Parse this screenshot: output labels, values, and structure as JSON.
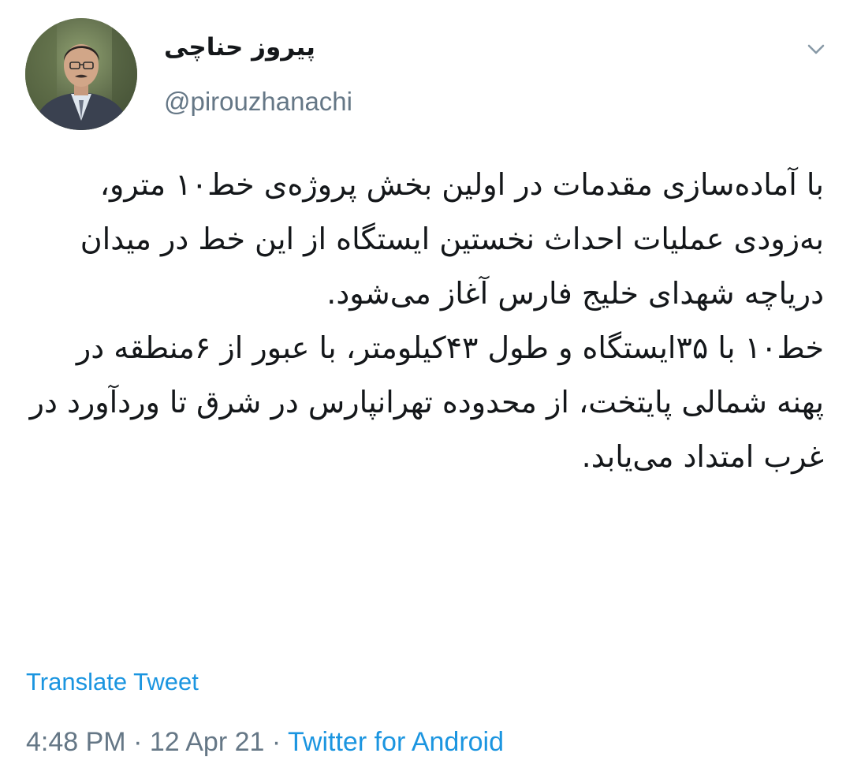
{
  "author": {
    "display_name": "پیروز حناچی",
    "handle": "@pirouzhanachi",
    "avatar_icon": "profile-photo"
  },
  "menu": {
    "caret_icon": "chevron-down-icon"
  },
  "tweet": {
    "paragraph_1": "با آماده‌سازی مقدمات در اولین بخش پروژه‌ی خط۱۰ مترو، به‌زودی عملیات احداث نخستین ایستگاه از این خط در میدان دریاچه شهدای خلیج فارس آغاز می‌شود.",
    "paragraph_2": "خط۱۰ با ۳۵ایستگاه و طول ۴۳کیلومتر، با عبور از ۶منطقه در پهنه شمالی پایتخت، از محدوده تهرانپارس در شرق تا وردآورد در غرب امتداد می‌یابد."
  },
  "translate_label": "Translate Tweet",
  "meta": {
    "time": "4:48 PM",
    "separator": " · ",
    "date": "12 Apr 21",
    "source": "Twitter for Android"
  },
  "colors": {
    "link": "#1b95e0",
    "secondary_text": "#657786",
    "primary_text": "#14171a"
  }
}
